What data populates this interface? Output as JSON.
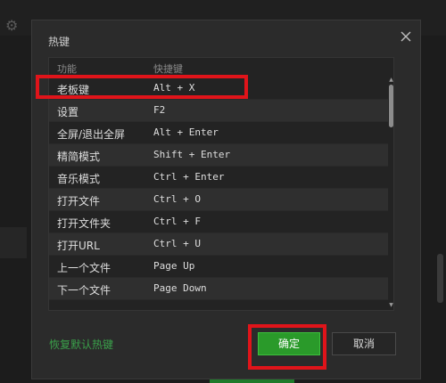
{
  "dialog": {
    "title": "热键",
    "close_icon": "close-icon"
  },
  "table": {
    "headers": {
      "function": "功能",
      "shortcut": "快捷键"
    },
    "rows": [
      {
        "function": "老板键",
        "shortcut": "Alt + X"
      },
      {
        "function": "设置",
        "shortcut": "F2"
      },
      {
        "function": "全屏/退出全屏",
        "shortcut": "Alt + Enter"
      },
      {
        "function": "精简模式",
        "shortcut": "Shift + Enter"
      },
      {
        "function": "音乐模式",
        "shortcut": "Ctrl + Enter"
      },
      {
        "function": "打开文件",
        "shortcut": "Ctrl + O"
      },
      {
        "function": "打开文件夹",
        "shortcut": "Ctrl + F"
      },
      {
        "function": "打开URL",
        "shortcut": "Ctrl + U"
      },
      {
        "function": "上一个文件",
        "shortcut": "Page Up"
      },
      {
        "function": "下一个文件",
        "shortcut": "Page Down"
      }
    ]
  },
  "footer": {
    "restore_label": "恢复默认热键",
    "ok_label": "确定",
    "cancel_label": "取消"
  },
  "colors": {
    "highlight": "#e0141a",
    "ok_button": "#2a9a2a",
    "restore_link": "#3aa04a"
  },
  "icons": {
    "background_settings": "gear-icon",
    "scroll_up": "chevron-up-icon",
    "scroll_down": "chevron-down-icon"
  }
}
